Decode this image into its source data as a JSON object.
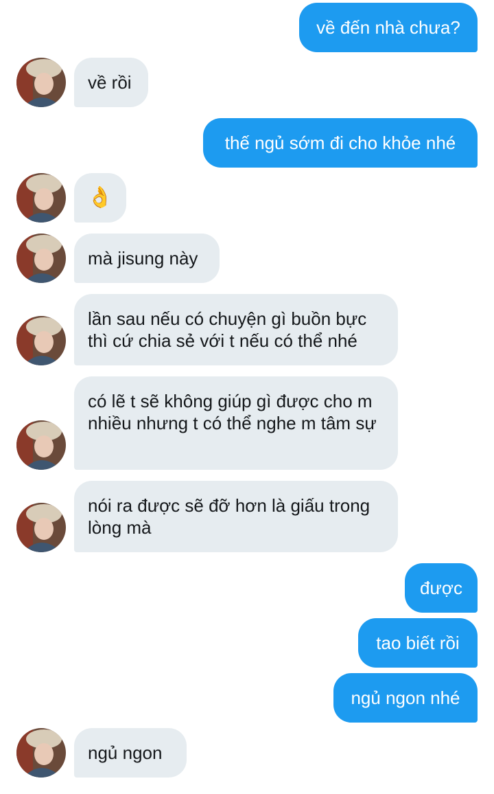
{
  "messages": [
    {
      "side": "out",
      "text": "về đến nhà chưa?"
    },
    {
      "side": "in",
      "text": "về rồi"
    },
    {
      "side": "out",
      "text": "thế ngủ sớm đi cho khỏe nhé"
    },
    {
      "side": "in",
      "text": "👌",
      "emoji": "ok-hand"
    },
    {
      "side": "in",
      "text": "mà jisung này"
    },
    {
      "side": "in",
      "text": "lần sau nếu có chuyện gì buồn bực thì cứ chia sẻ với t nếu có thể nhé"
    },
    {
      "side": "in",
      "text": "có lẽ t sẽ không giúp gì được cho m nhiều nhưng t có thể nghe m tâm sự"
    },
    {
      "side": "in",
      "text": "nói ra được sẽ đỡ hơn là giấu trong lòng mà"
    },
    {
      "side": "out",
      "text": "được"
    },
    {
      "side": "out",
      "text": "tao biết rồi"
    },
    {
      "side": "out",
      "text": "ngủ ngon nhé"
    },
    {
      "side": "in",
      "text": "ngủ ngon"
    }
  ],
  "colors": {
    "outgoing_bubble": "#1d9bf0",
    "incoming_bubble": "#e6ecf0",
    "incoming_text": "#14171a"
  },
  "icons": {
    "avatar": "contact-avatar-photo"
  }
}
